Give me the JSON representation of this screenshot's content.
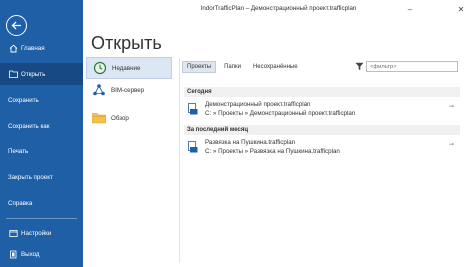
{
  "window": {
    "title": "IndorTrafficPlan – Демонстрационный проект.trafficplan",
    "minimize": "–",
    "close": "✕"
  },
  "sidebar": {
    "items": [
      {
        "label": "Главная"
      },
      {
        "label": "Открыть"
      },
      {
        "label": "Сохранить"
      },
      {
        "label": "Сохранить как"
      },
      {
        "label": "Печать"
      },
      {
        "label": "Закрыть проект"
      },
      {
        "label": "Справка"
      },
      {
        "label": "Настройки"
      },
      {
        "label": "Выход"
      }
    ]
  },
  "main": {
    "heading": "Открыть",
    "sources": [
      {
        "label": "Недавние"
      },
      {
        "label": "BIM-сервер"
      },
      {
        "label": "Обзор"
      }
    ],
    "tabs": [
      {
        "label": "Проекты"
      },
      {
        "label": "Папки"
      },
      {
        "label": "Несохранённые"
      }
    ],
    "filter": {
      "placeholder": "<фильтр>"
    },
    "groups": [
      {
        "label": "Сегодня",
        "files": [
          {
            "name": "Демонстрационный проект.trafficplan",
            "path": "C: » Проекты » Демонстрационный проект.trafficplan"
          }
        ]
      },
      {
        "label": "За последний месяц",
        "files": [
          {
            "name": "Развязка на Пушкина.trafficplan",
            "path": "C: » Проекты » Развязка на Пушкина.trafficplan"
          }
        ]
      }
    ]
  },
  "colors": {
    "sidebar": "#1f5fa6",
    "sidebar_active": "#174a85",
    "accent": "#1f5fa6"
  }
}
